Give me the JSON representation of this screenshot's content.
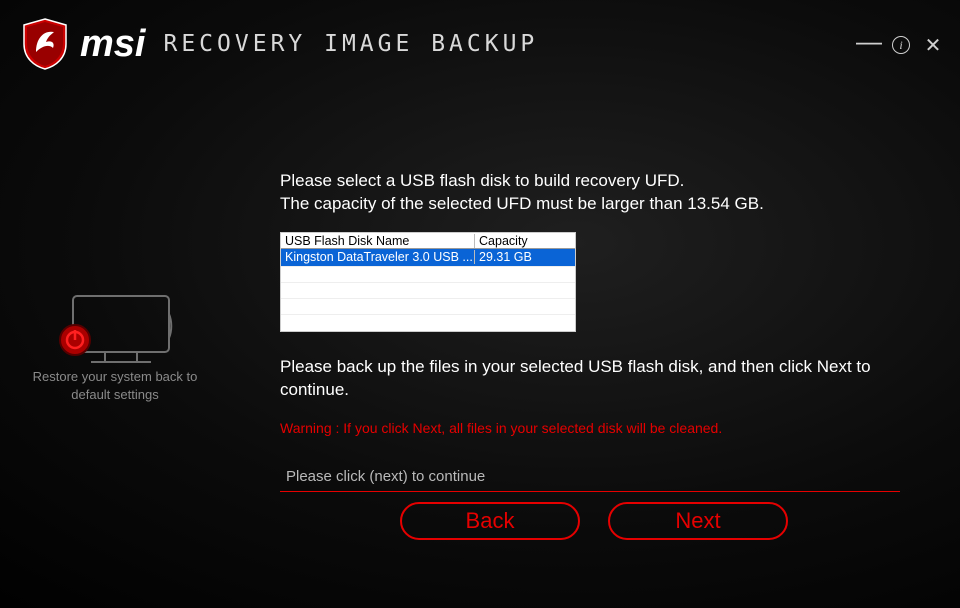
{
  "brand_text": "msi",
  "app_title": "RECOVERY IMAGE BACKUP",
  "side_caption": "Restore your system back to default settings",
  "instruction_line1": "Please select a USB flash disk to build recovery UFD.",
  "instruction_line2": "The capacity of the selected UFD must be larger than 13.54 GB.",
  "table": {
    "header_name": "USB Flash Disk Name",
    "header_capacity": "Capacity",
    "rows": [
      {
        "name": "Kingston DataTraveler 3.0 USB ...",
        "capacity": "29.31  GB",
        "selected": true
      }
    ]
  },
  "instruction2": "Please back up the files in your selected USB flash disk, and then click Next to continue.",
  "warning": "Warning : If you click Next, all files in your selected disk will be cleaned.",
  "step_hint": "Please click (next) to continue",
  "buttons": {
    "back": "Back",
    "next": "Next"
  },
  "colors": {
    "accent": "#e60000",
    "select_bg": "#0a64d6"
  }
}
